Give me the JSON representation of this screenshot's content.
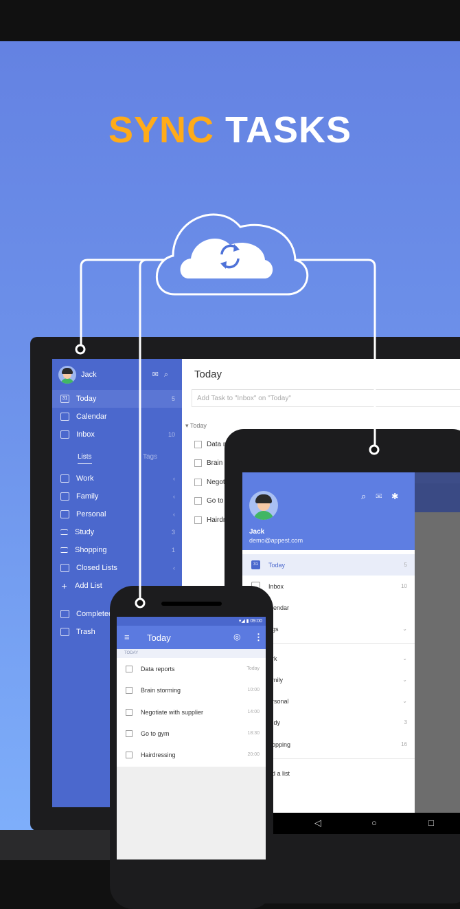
{
  "headline": {
    "part1": "SYNC",
    "part2": "TASKS",
    "color1": "#ffab19",
    "color2": "#ffffff"
  },
  "cloud": {
    "icon": "sync-icon"
  },
  "laptop": {
    "user": "Jack",
    "header_icons": [
      "mail-icon",
      "search-icon"
    ],
    "nav": [
      {
        "label": "Today",
        "count": "5",
        "icon": "calendar-31-icon",
        "selected": true
      },
      {
        "label": "Calendar",
        "count": "",
        "icon": "calendar-icon"
      },
      {
        "label": "Inbox",
        "count": "10",
        "icon": "inbox-icon"
      }
    ],
    "tabs": [
      "Lists",
      "Tags"
    ],
    "lists": [
      {
        "label": "Work",
        "count": "‹",
        "icon": "folder-icon"
      },
      {
        "label": "Family",
        "count": "‹",
        "icon": "folder-icon"
      },
      {
        "label": "Personal",
        "count": "‹",
        "icon": "folder-icon"
      },
      {
        "label": "Study",
        "count": "3",
        "icon": "list-icon"
      },
      {
        "label": "Shopping",
        "count": "1",
        "icon": "shopping-list-icon"
      },
      {
        "label": "Closed Lists",
        "count": "‹",
        "icon": "archive-folder-icon"
      },
      {
        "label": "Add List",
        "count": "",
        "icon": "plus-icon"
      }
    ],
    "bottom": [
      {
        "label": "Completed",
        "icon": "check-icon"
      },
      {
        "label": "Trash",
        "icon": "trash-icon"
      }
    ],
    "main_title": "Today",
    "add_placeholder": "Add Task to \"Inbox\" on \"Today\"",
    "section": "Today",
    "tasks": [
      "Data r",
      "Brain s",
      "Negot",
      "Go to",
      "Hairdr"
    ]
  },
  "tablet": {
    "name": "Jack",
    "email": "demo@appest.com",
    "header_icons": [
      "search-icon",
      "mail-icon",
      "settings-icon"
    ],
    "items": [
      {
        "label": "Today",
        "count": "5",
        "selected": true
      },
      {
        "label": "Inbox",
        "count": "10"
      },
      {
        "label": "alendar",
        "count": ""
      },
      {
        "label": "ags",
        "count": "⌄"
      },
      {
        "label": "ork",
        "count": "⌄"
      },
      {
        "label": "amily",
        "count": "⌄"
      },
      {
        "label": "ersonal",
        "count": "⌄"
      },
      {
        "label": "tudy",
        "count": "3"
      },
      {
        "label": "hopping",
        "count": "16"
      },
      {
        "label": "dd a list",
        "count": ""
      }
    ],
    "nav": [
      "◁",
      "○",
      "□"
    ]
  },
  "phone": {
    "status": "▾◢ ▮ 09:00",
    "title": "Today",
    "section": "TODAY",
    "tasks": [
      {
        "label": "Data reports",
        "time": "Today"
      },
      {
        "label": "Brain storming",
        "time": "10:00"
      },
      {
        "label": "Negotiate with supplier",
        "time": "14:00"
      },
      {
        "label": "Go to gym",
        "time": "18:30"
      },
      {
        "label": "Hairdressing",
        "time": "20:00"
      }
    ]
  }
}
